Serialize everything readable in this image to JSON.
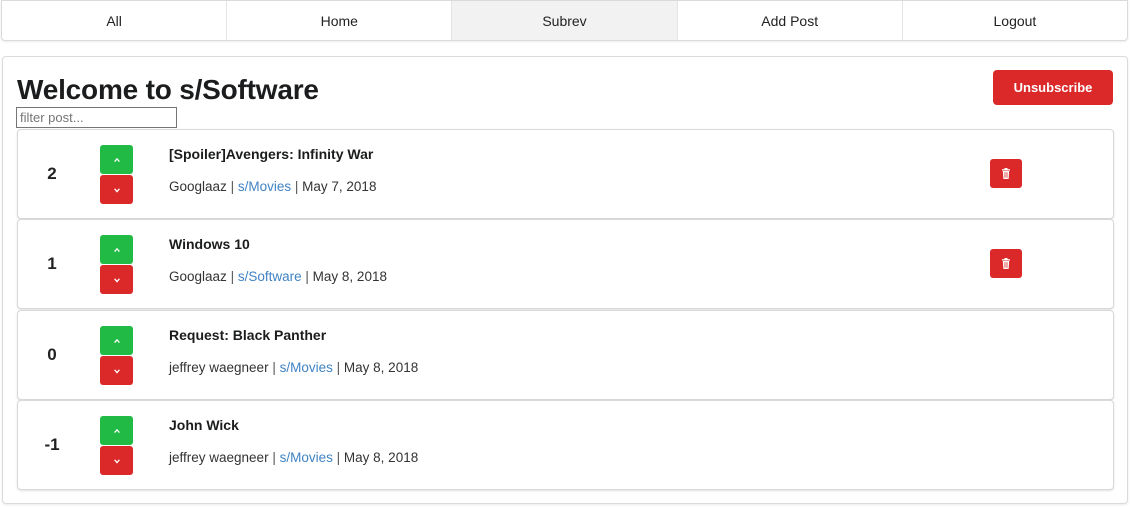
{
  "nav": {
    "items": [
      {
        "label": "All",
        "active": false
      },
      {
        "label": "Home",
        "active": false
      },
      {
        "label": "Subrev",
        "active": true
      },
      {
        "label": "Add Post",
        "active": false
      },
      {
        "label": "Logout",
        "active": false
      }
    ]
  },
  "header": {
    "title": "Welcome to s/Software",
    "unsubscribe_label": "Unsubscribe"
  },
  "filter": {
    "placeholder": "filter post...",
    "value": ""
  },
  "posts": [
    {
      "score": "2",
      "title": "[Spoiler]Avengers: Infinity War",
      "author": "Googlaaz",
      "subrev": "s/Movies",
      "date": "May 7, 2018",
      "deletable": true
    },
    {
      "score": "1",
      "title": "Windows 10",
      "author": "Googlaaz",
      "subrev": "s/Software",
      "date": "May 8, 2018",
      "deletable": true
    },
    {
      "score": "0",
      "title": "Request: Black Panther",
      "author": "jeffrey waegneer",
      "subrev": "s/Movies",
      "date": "May 8, 2018",
      "deletable": false
    },
    {
      "score": "-1",
      "title": "John Wick",
      "author": "jeffrey waegneer",
      "subrev": "s/Movies",
      "date": "May 8, 2018",
      "deletable": false
    }
  ],
  "separator": "|",
  "icons": {
    "upvote": "chevron-up-icon",
    "downvote": "chevron-down-icon",
    "delete": "trash-icon"
  },
  "colors": {
    "green": "#21ba45",
    "red": "#db2828",
    "link": "#4183c4"
  }
}
